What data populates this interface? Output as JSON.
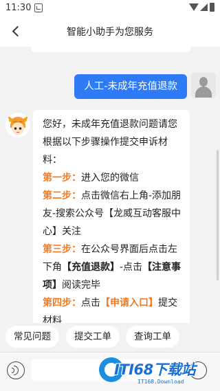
{
  "status_bar": {
    "time": "11:30"
  },
  "nav": {
    "title": "智能小助手为您服务"
  },
  "user_message": "人工-未成年充值退款",
  "bot_message": {
    "intro": "您好，未成年充值退款问题请您根据以下步骤操作提交申诉材料：",
    "steps": [
      {
        "label": "第一步：",
        "parts": [
          {
            "text": "进入您的微信",
            "style": "normal"
          }
        ]
      },
      {
        "label": "第二步：",
        "parts": [
          {
            "text": "点击微信右上角-添加朋友-搜索公众号【龙威互动客服中心】关注",
            "style": "normal"
          }
        ]
      },
      {
        "label": "第三步：",
        "parts": [
          {
            "text": "在公众号界面后点击左下角",
            "style": "normal"
          },
          {
            "text": "【充值退款】",
            "style": "bold"
          },
          {
            "text": "-点击",
            "style": "normal"
          },
          {
            "text": "【注意事项】",
            "style": "bold"
          },
          {
            "text": "阅读完毕",
            "style": "normal"
          }
        ]
      },
      {
        "label": "第四步：",
        "parts": [
          {
            "text": "点击",
            "style": "normal"
          },
          {
            "text": "【申请入口】",
            "style": "orange"
          },
          {
            "text": "提交材料",
            "style": "normal"
          }
        ]
      }
    ]
  },
  "quick_replies": [
    "常见问题",
    "提交工单",
    "查询工单"
  ],
  "input": {
    "placeholder": ""
  },
  "watermark": {
    "brand": "ITI68下载站",
    "sub": "IT168.Download"
  },
  "colors": {
    "accent": "#2f7bf5",
    "step_label": "#f47a20"
  }
}
